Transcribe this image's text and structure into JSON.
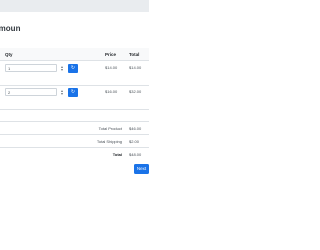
{
  "page": {
    "title": "arfkmoun"
  },
  "table": {
    "headers": {
      "qty": "Qty",
      "price": "Price",
      "total": "Total"
    },
    "rows": [
      {
        "qty": "1",
        "price": "$14.00",
        "total": "$14.00",
        "update_icon": "refresh-icon"
      },
      {
        "qty": "2",
        "price": "$16.00",
        "total": "$32.00",
        "update_icon": "refresh-icon"
      }
    ]
  },
  "summary": {
    "total_product_label": "Total Product",
    "total_product_value": "$46.00",
    "total_shipping_label": "Total Shipping",
    "total_shipping_value": "$2.00",
    "total_label": "Total",
    "total_value": "$48.00"
  },
  "actions": {
    "next_label": "Next"
  },
  "colors": {
    "accent": "#1a73e8",
    "top_bar": "#e9ecef",
    "header_bg": "#f8f9fa"
  }
}
